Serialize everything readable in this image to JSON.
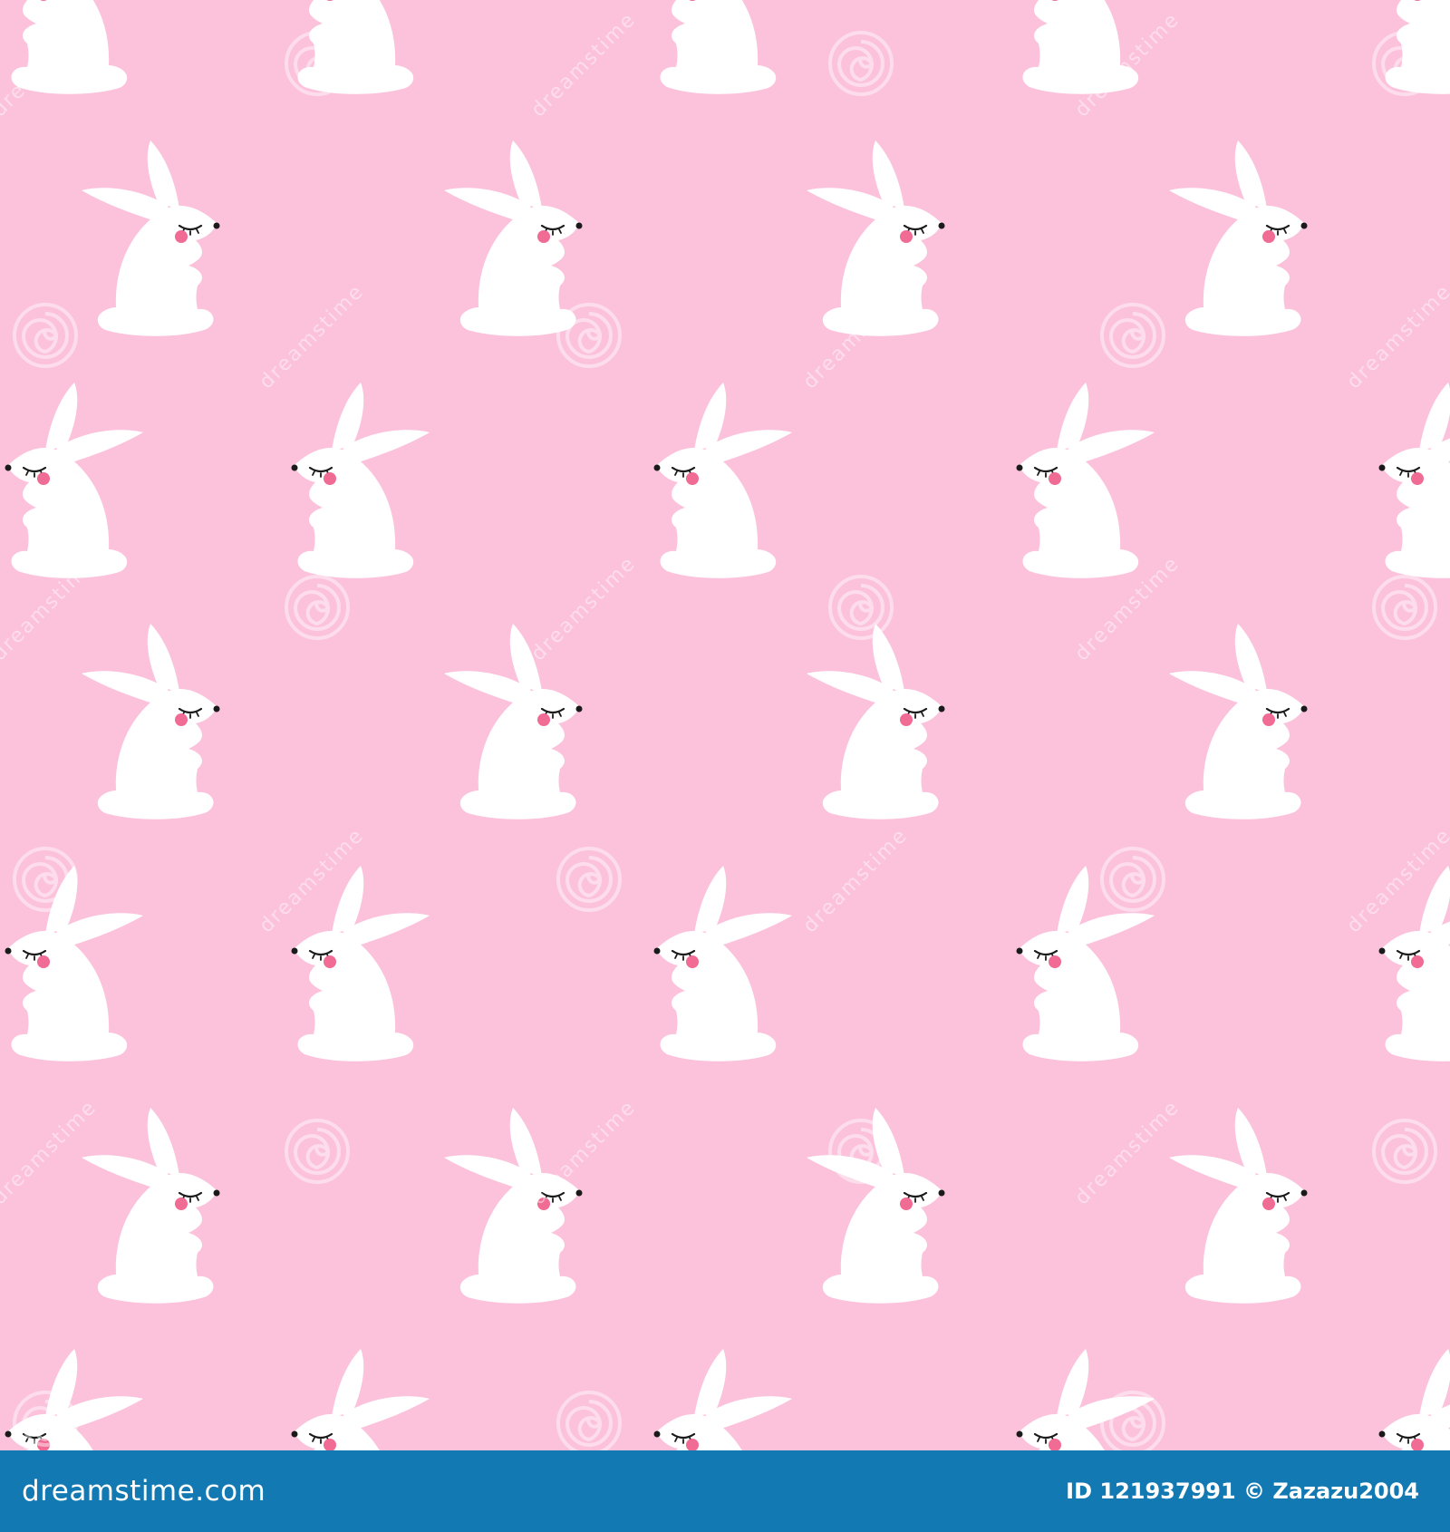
{
  "pattern": {
    "background_color": "#fcc2db",
    "bunny_color": "#ffffff",
    "cheek_color": "#f06c95",
    "eye_color": "#1a1a1a",
    "bunny_icon": "rabbit-icon",
    "watermark_icon": "spiral-logo-icon",
    "watermark_text": "dreamstime"
  },
  "footer": {
    "brand": "dreamstime.com",
    "image_id": "ID 121937991",
    "copyright": "© Zazazu2004",
    "background_color": "#1279b3"
  }
}
